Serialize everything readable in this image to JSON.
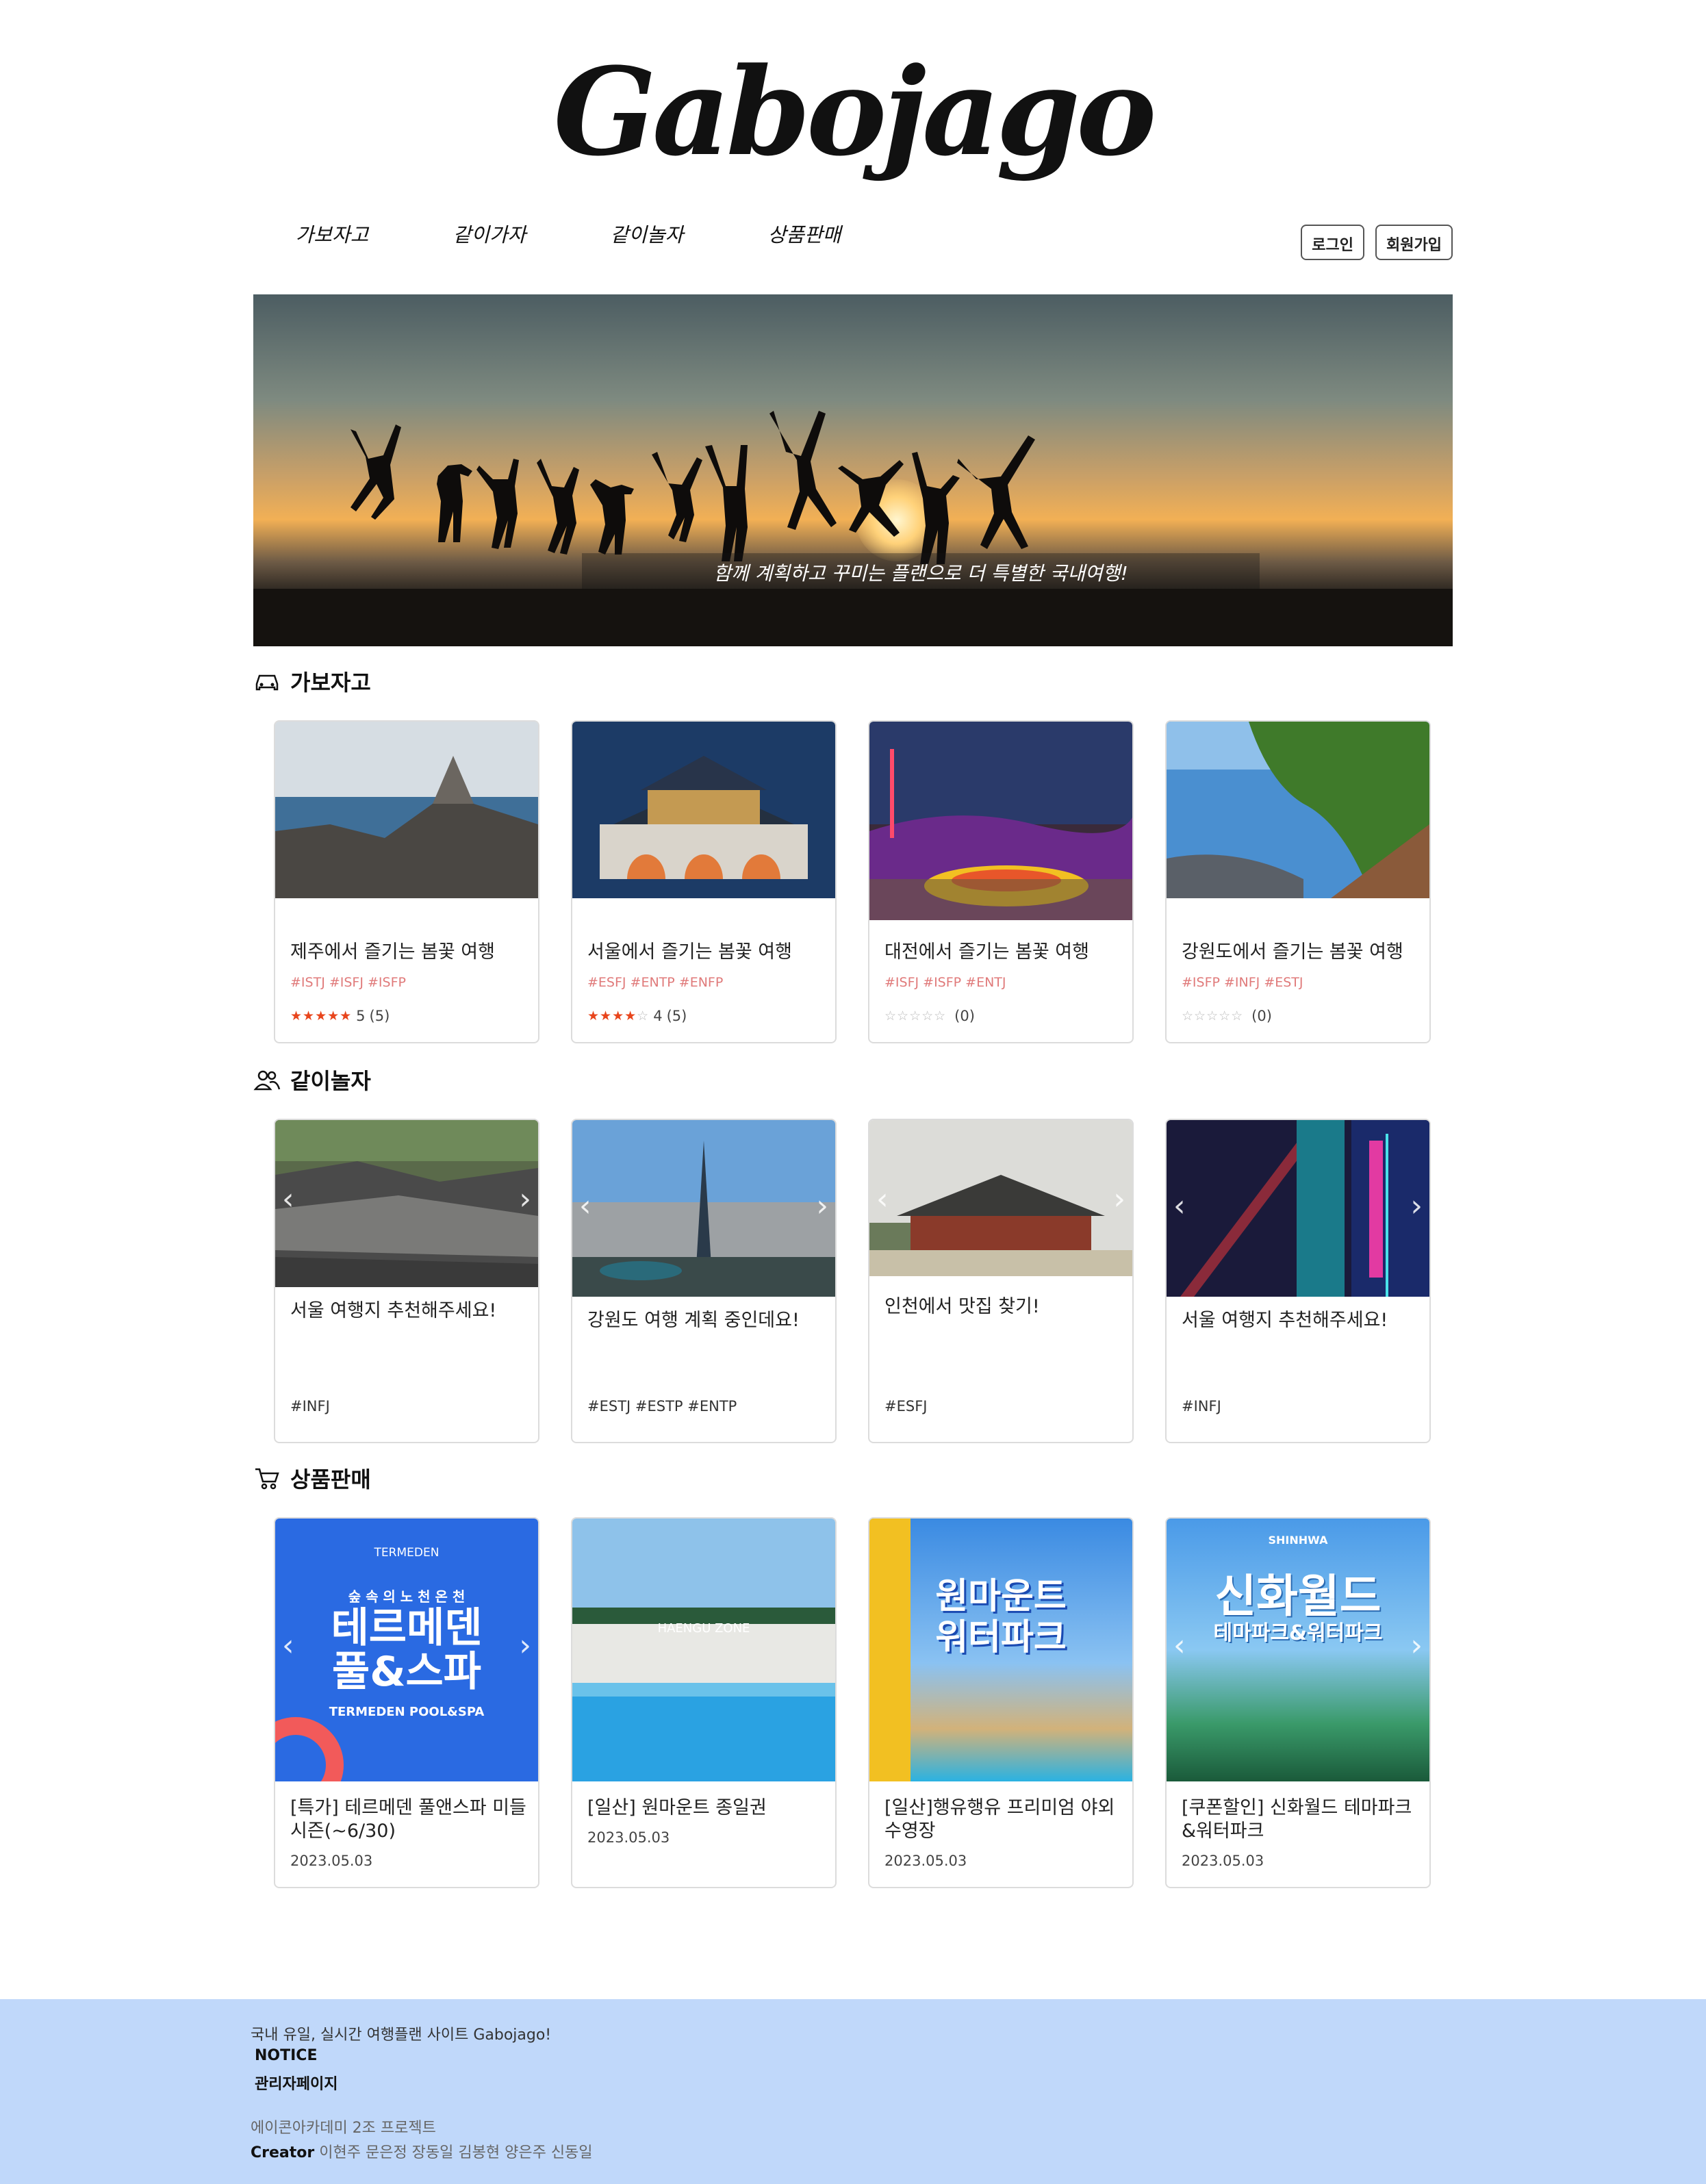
{
  "logo": "Gabojago",
  "nav": [
    "가보자고",
    "같이가자",
    "같이놀자",
    "상품판매"
  ],
  "auth": {
    "login": "로그인",
    "signup": "회원가입"
  },
  "hero": {
    "caption": "함께 계획하고 꾸미는 플랜으로 더 특별한 국내여행!"
  },
  "sections": {
    "travel": {
      "title": "가보자고",
      "icon": "car-icon",
      "cards": [
        {
          "title": "제주에서 즐기는 봄꽃 여행",
          "tags": "#ISTJ  #ISFJ  #ISFP",
          "stars": 5,
          "rating": "5",
          "count": "(5)"
        },
        {
          "title": "서울에서 즐기는 봄꽃 여행",
          "tags": "#ESFJ  #ENTP  #ENFP",
          "stars": 4,
          "rating": "4",
          "count": "(5)"
        },
        {
          "title": "대전에서 즐기는 봄꽃 여행",
          "tags": "#ISFJ  #ISFP  #ENTJ",
          "stars": 0,
          "rating": "",
          "count": "(0)"
        },
        {
          "title": "강원도에서 즐기는 봄꽃 여행",
          "tags": "#ISFP  #INFJ  #ESTJ",
          "stars": 0,
          "rating": "",
          "count": "(0)"
        }
      ]
    },
    "play": {
      "title": "같이놀자",
      "icon": "people-icon",
      "cards": [
        {
          "title": "서울 여행지 추천해주세요!",
          "tags": "#INFJ"
        },
        {
          "title": "강원도 여행 계획 중인데요!",
          "tags": "#ESTJ #ESTP #ENTP"
        },
        {
          "title": "인천에서 맛집 찾기!",
          "tags": "#ESFJ"
        },
        {
          "title": "서울 여행지 추천해주세요!",
          "tags": "#INFJ"
        }
      ]
    },
    "shop": {
      "title": "상품판매",
      "icon": "cart-icon",
      "cards": [
        {
          "title": "[특가] 테르메덴 풀앤스파 미들\n시즌(~6/30)",
          "date": "2023.05.03",
          "banner_main": "테르메덴\n풀&스파",
          "banner_sub": "숲 속 의 노 천 온 천",
          "banner_en": "TERMEDEN POOL&SPA",
          "banner_brand": "TERMEDEN"
        },
        {
          "title": "[일산] 원마운트 종일권",
          "date": "2023.05.03",
          "banner_brand": "HAENGU ZONE"
        },
        {
          "title": "[일산]행유행유 프리미엄 야외\n수영장",
          "date": "2023.05.03",
          "banner_main": "원마운트\n워터파크"
        },
        {
          "title": "[쿠폰할인] 신화월드 테마파크\n&워터파크",
          "date": "2023.05.03",
          "banner_main": "신화월드",
          "banner_sub": "테마파크&워터파크",
          "banner_brand": "SHINHWA"
        }
      ]
    }
  },
  "footer": {
    "slogan": "국내 유일, 실시간 여행플랜 사이트 Gabojago!",
    "notice": "NOTICE",
    "admin": "관리자페이지",
    "project": "에이콘아카데미 2조 프로젝트",
    "creator_label": "Creator",
    "creators": "이현주 문은정 장동일 김봉현 양은주 신동일"
  },
  "colors": {
    "footer_bg": "#c0d8fa",
    "tag_pink": "#e07a7a",
    "star": "#e8451c"
  }
}
